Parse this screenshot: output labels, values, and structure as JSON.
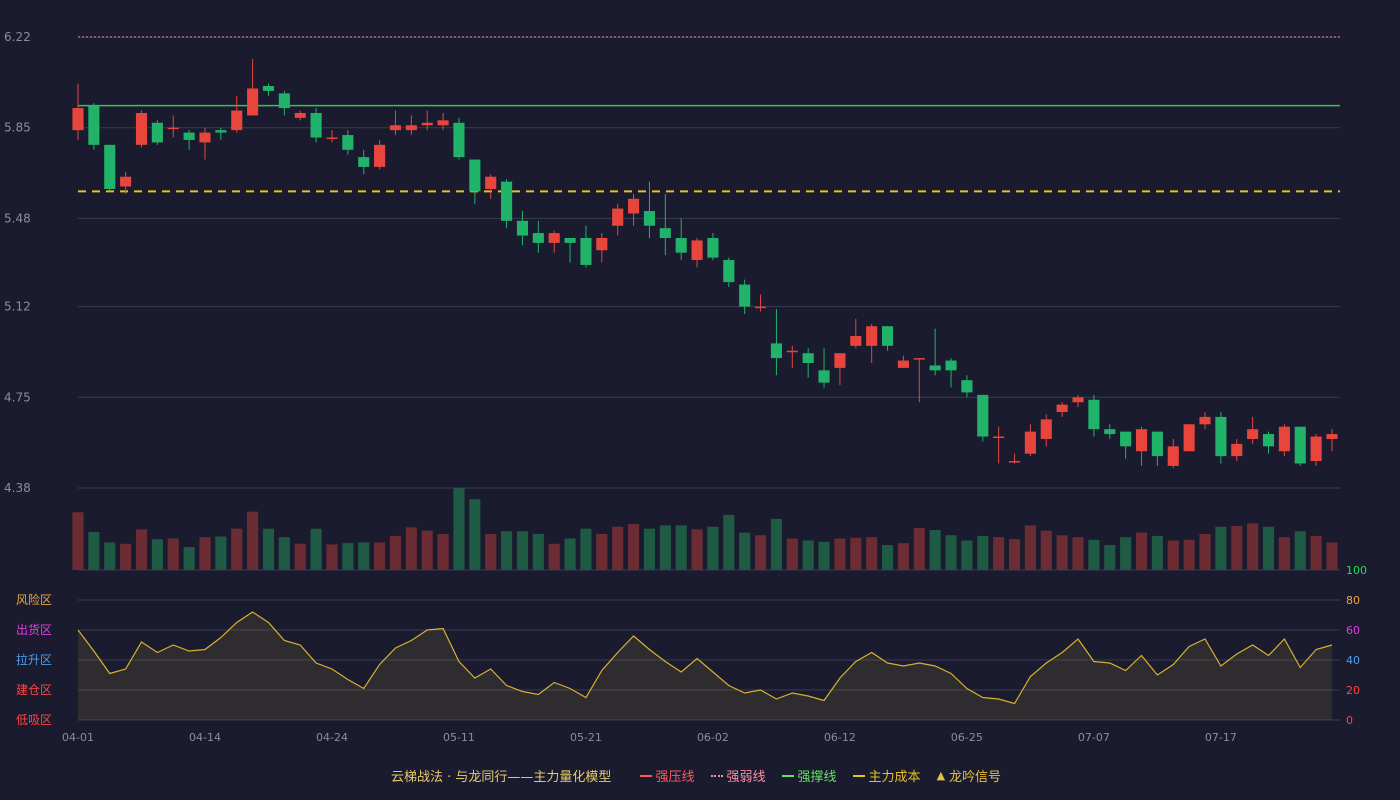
{
  "colors": {
    "background": "#1a1b2e",
    "up": "#e8453c",
    "down": "#22b36a",
    "vol_up": "#6b2d33",
    "vol_down": "#1f5a45",
    "grid": "#3a3b52",
    "strong_pressure": "#ff5a5a",
    "strong_weak": "#ff8fa3",
    "strong_support": "#3fbf5a",
    "main_cost": "#e8c020",
    "signal": "#e8c040",
    "osc_line": "#d8b030"
  },
  "legend": {
    "title": "云梯战法 · 与龙同行——主力量化模型",
    "items": [
      {
        "label": "强压线",
        "color": "#ff5a5a",
        "style": "solid"
      },
      {
        "label": "强弱线",
        "color": "#ff8fa3",
        "style": "dotted"
      },
      {
        "label": "强撑线",
        "color": "#5fe35f",
        "style": "solid"
      },
      {
        "label": "主力成本",
        "color": "#e8c020",
        "style": "dashed"
      },
      {
        "label": "龙吟信号",
        "color": "#e8c040",
        "style": "triangle"
      }
    ]
  },
  "chart_data": {
    "type": "candlestick",
    "y_ticks": [
      "6.22",
      "5.85",
      "5.48",
      "5.12",
      "4.75",
      "4.38"
    ],
    "ylim": [
      4.38,
      6.22
    ],
    "x_ticks": [
      {
        "index": 0,
        "label": "04-01"
      },
      {
        "index": 8,
        "label": "04-14"
      },
      {
        "index": 16,
        "label": "04-24"
      },
      {
        "index": 24,
        "label": "05-11"
      },
      {
        "index": 32,
        "label": "05-21"
      },
      {
        "index": 40,
        "label": "06-02"
      },
      {
        "index": 48,
        "label": "06-12"
      },
      {
        "index": 56,
        "label": "06-25"
      },
      {
        "index": 64,
        "label": "07-07"
      },
      {
        "index": 72,
        "label": "07-17"
      }
    ],
    "reference_lines": {
      "strong_weak": 6.22,
      "strong_support": 5.94,
      "main_cost": 5.59
    },
    "candles": [
      [
        5.84,
        5.93,
        5.8,
        6.03
      ],
      [
        5.94,
        5.78,
        5.76,
        5.95
      ],
      [
        5.78,
        5.6,
        5.59,
        5.78
      ],
      [
        5.61,
        5.65,
        5.58,
        5.67
      ],
      [
        5.78,
        5.91,
        5.77,
        5.92
      ],
      [
        5.87,
        5.79,
        5.78,
        5.88
      ],
      [
        5.85,
        5.85,
        5.81,
        5.9
      ],
      [
        5.83,
        5.8,
        5.76,
        5.84
      ],
      [
        5.79,
        5.83,
        5.72,
        5.85
      ],
      [
        5.84,
        5.83,
        5.8,
        5.85
      ],
      [
        5.84,
        5.92,
        5.83,
        5.98
      ],
      [
        5.9,
        6.01,
        5.9,
        6.13
      ],
      [
        6.02,
        6.0,
        5.98,
        6.03
      ],
      [
        5.99,
        5.93,
        5.9,
        6.0
      ],
      [
        5.89,
        5.91,
        5.88,
        5.92
      ],
      [
        5.91,
        5.81,
        5.79,
        5.93
      ],
      [
        5.81,
        5.81,
        5.79,
        5.84
      ],
      [
        5.82,
        5.76,
        5.74,
        5.84
      ],
      [
        5.73,
        5.69,
        5.66,
        5.76
      ],
      [
        5.69,
        5.78,
        5.68,
        5.8
      ],
      [
        5.84,
        5.86,
        5.82,
        5.92
      ],
      [
        5.84,
        5.86,
        5.82,
        5.9
      ],
      [
        5.86,
        5.87,
        5.84,
        5.92
      ],
      [
        5.86,
        5.88,
        5.84,
        5.91
      ],
      [
        5.87,
        5.73,
        5.72,
        5.89
      ],
      [
        5.72,
        5.59,
        5.54,
        5.72
      ],
      [
        5.6,
        5.65,
        5.56,
        5.66
      ],
      [
        5.63,
        5.47,
        5.44,
        5.64
      ],
      [
        5.47,
        5.41,
        5.37,
        5.51
      ],
      [
        5.42,
        5.38,
        5.34,
        5.47
      ],
      [
        5.38,
        5.42,
        5.34,
        5.43
      ],
      [
        5.4,
        5.38,
        5.3,
        5.4
      ],
      [
        5.4,
        5.29,
        5.28,
        5.45
      ],
      [
        5.35,
        5.4,
        5.3,
        5.42
      ],
      [
        5.45,
        5.52,
        5.41,
        5.54
      ],
      [
        5.5,
        5.56,
        5.45,
        5.58
      ],
      [
        5.51,
        5.45,
        5.4,
        5.63
      ],
      [
        5.44,
        5.4,
        5.33,
        5.58
      ],
      [
        5.4,
        5.34,
        5.31,
        5.48
      ],
      [
        5.31,
        5.39,
        5.28,
        5.4
      ],
      [
        5.4,
        5.32,
        5.31,
        5.42
      ],
      [
        5.31,
        5.22,
        5.2,
        5.32
      ],
      [
        5.21,
        5.12,
        5.09,
        5.23
      ],
      [
        5.12,
        5.12,
        5.1,
        5.17
      ],
      [
        4.97,
        4.91,
        4.84,
        5.11
      ],
      [
        4.94,
        4.94,
        4.87,
        4.96
      ],
      [
        4.93,
        4.89,
        4.83,
        4.95
      ],
      [
        4.86,
        4.81,
        4.79,
        4.95
      ],
      [
        4.87,
        4.93,
        4.8,
        4.93
      ],
      [
        4.96,
        5.0,
        4.95,
        5.07
      ],
      [
        4.96,
        5.04,
        4.89,
        5.05
      ],
      [
        5.04,
        4.96,
        4.94,
        5.04
      ],
      [
        4.87,
        4.9,
        4.87,
        4.92
      ],
      [
        4.91,
        4.91,
        4.73,
        4.91
      ],
      [
        4.88,
        4.86,
        4.84,
        5.03
      ],
      [
        4.9,
        4.86,
        4.79,
        4.91
      ],
      [
        4.82,
        4.77,
        4.75,
        4.84
      ],
      [
        4.76,
        4.59,
        4.57,
        4.76
      ],
      [
        4.59,
        4.59,
        4.48,
        4.63
      ],
      [
        4.49,
        4.49,
        4.48,
        4.52
      ],
      [
        4.52,
        4.61,
        4.51,
        4.64
      ],
      [
        4.58,
        4.66,
        4.55,
        4.68
      ],
      [
        4.69,
        4.72,
        4.67,
        4.73
      ],
      [
        4.73,
        4.75,
        4.71,
        4.76
      ],
      [
        4.74,
        4.62,
        4.59,
        4.76
      ],
      [
        4.62,
        4.6,
        4.58,
        4.64
      ],
      [
        4.61,
        4.55,
        4.5,
        4.61
      ],
      [
        4.53,
        4.62,
        4.47,
        4.63
      ],
      [
        4.61,
        4.51,
        4.47,
        4.61
      ],
      [
        4.47,
        4.55,
        4.46,
        4.58
      ],
      [
        4.53,
        4.64,
        4.53,
        4.64
      ],
      [
        4.64,
        4.67,
        4.62,
        4.69
      ],
      [
        4.67,
        4.51,
        4.48,
        4.69
      ],
      [
        4.51,
        4.56,
        4.49,
        4.58
      ],
      [
        4.58,
        4.62,
        4.56,
        4.67
      ],
      [
        4.6,
        4.55,
        4.52,
        4.61
      ],
      [
        4.53,
        4.63,
        4.51,
        4.64
      ],
      [
        4.63,
        4.48,
        4.47,
        4.63
      ],
      [
        4.49,
        4.59,
        4.47,
        4.6
      ],
      [
        4.58,
        4.6,
        4.53,
        4.62
      ]
    ],
    "volume": [
      88,
      58,
      42,
      40,
      62,
      47,
      48,
      35,
      50,
      51,
      63,
      89,
      63,
      50,
      40,
      63,
      39,
      41,
      42,
      42,
      52,
      65,
      60,
      55,
      125,
      108,
      55,
      59,
      59,
      55,
      40,
      48,
      63,
      55,
      66,
      70,
      63,
      68,
      68,
      62,
      66,
      84,
      57,
      53,
      78,
      48,
      45,
      43,
      48,
      49,
      50,
      38,
      41,
      64,
      61,
      53,
      45,
      52,
      50,
      47,
      68,
      60,
      53,
      50,
      46,
      38,
      50,
      57,
      52,
      45,
      46,
      55,
      66,
      67,
      71,
      66,
      50,
      59,
      52,
      42
    ],
    "oscillator": {
      "zones": [
        "风险区",
        "出货区",
        "拉升区",
        "建仓区",
        "低吸区"
      ],
      "zone_colors": [
        "#f2a33a",
        "#e040e0",
        "#4a9ef0",
        "#ff4444",
        "#ff4444"
      ],
      "right_ticks": [
        "100",
        "80",
        "60",
        "40",
        "20",
        "0"
      ],
      "right_tick_colors": [
        "#22dd55",
        "#f2a33a",
        "#e040e0",
        "#4a9ef0",
        "#ff4444",
        "#ff4444"
      ],
      "values": [
        60,
        46,
        31,
        34,
        52,
        45,
        50,
        46,
        47,
        55,
        65,
        72,
        65,
        53,
        50,
        38,
        34,
        27,
        21,
        37,
        48,
        53,
        60,
        61,
        39,
        28,
        34,
        23,
        19,
        17,
        25,
        21,
        15,
        33,
        45,
        56,
        47,
        39,
        32,
        41,
        32,
        23,
        18,
        20,
        14,
        18,
        16,
        13,
        28,
        39,
        45,
        38,
        36,
        38,
        36,
        31,
        21,
        15,
        14,
        11,
        29,
        38,
        45,
        54,
        39,
        38,
        33,
        43,
        30,
        37,
        49,
        54,
        36,
        44,
        50,
        43,
        54,
        35,
        47,
        50
      ]
    }
  }
}
